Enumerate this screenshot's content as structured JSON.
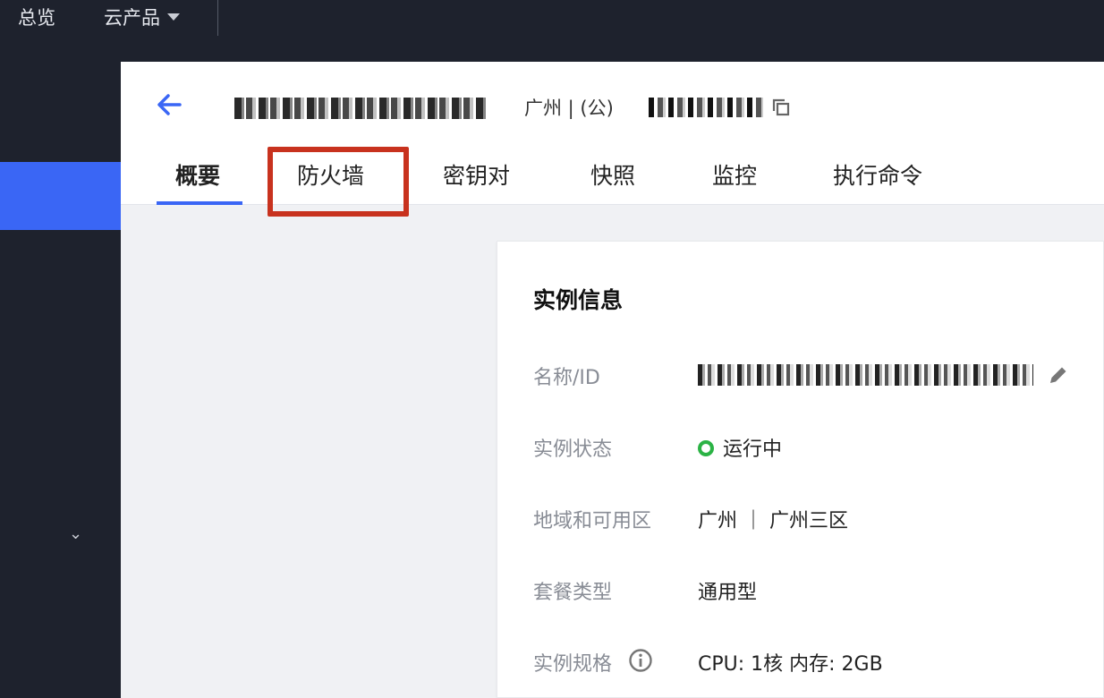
{
  "topbar": {
    "overview": "总览",
    "products": "云产品"
  },
  "header": {
    "region": "广州 | (公)"
  },
  "tabs": [
    {
      "label": "概要"
    },
    {
      "label": "防火墙"
    },
    {
      "label": "密钥对"
    },
    {
      "label": "快照"
    },
    {
      "label": "监控"
    },
    {
      "label": "执行命令"
    }
  ],
  "card": {
    "title": "实例信息",
    "rows": [
      {
        "label": "名称/ID",
        "value": ""
      },
      {
        "label": "实例状态",
        "value": "运行中"
      },
      {
        "label": "地域和可用区",
        "value": "广州 ｜ 广州三区"
      },
      {
        "label": "套餐类型",
        "value": "通用型"
      },
      {
        "label": "实例规格",
        "value": "CPU: 1核 内存: 2GB"
      }
    ]
  },
  "colors": {
    "accent": "#3a66f5",
    "topbar": "#1e222d",
    "highlight": "#c8321e",
    "running": "#2bb345"
  },
  "icons": [
    "back-arrow-icon",
    "copy-icon",
    "edit-icon",
    "info-icon",
    "chevron-down-icon",
    "caret-down-icon"
  ]
}
